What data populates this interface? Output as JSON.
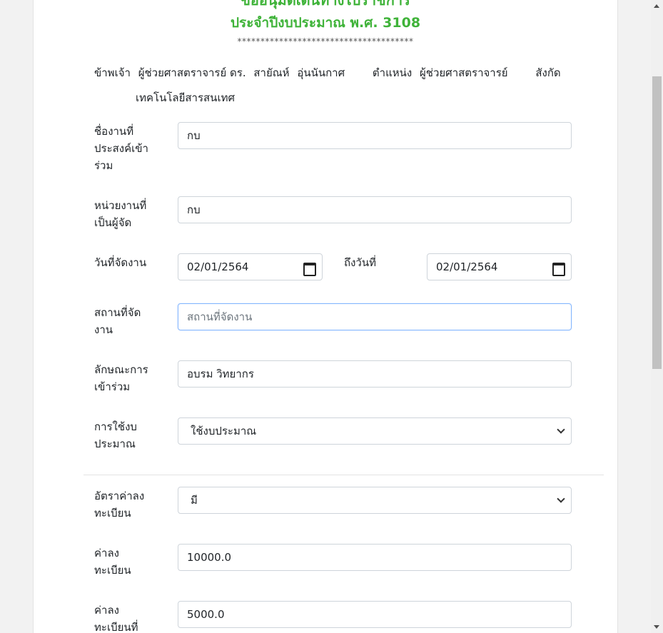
{
  "header": {
    "title_cut": "ขออนุมัติเดินทางไปราชการ",
    "subtitle": "ประจำปีงบประมาณ พ.ศ. 3108",
    "stars": "**************************************"
  },
  "info": {
    "prefix": "ข้าพเจ้า",
    "title": "ผู้ช่วยศาสตราจารย์ ดร.",
    "first_name": "สายัณห์",
    "last_name": "อุ่นนันกาศ",
    "position_label": "ตำแหน่ง",
    "position": "ผู้ช่วยศาสตราจารย์",
    "affiliation_label": "สังกัด",
    "affiliation": "เทคโนโลยีสารสนเทศ"
  },
  "form": {
    "event_name": {
      "label_1": "ชื่องานที่",
      "label_2": "ประสงค์เข้า",
      "label_3": "ร่วม",
      "value": "กบ"
    },
    "organizer": {
      "label_1": "หน่วยงานที่",
      "label_2": "เป็นผู้จัด",
      "value": "กบ"
    },
    "start_date": {
      "label": "วันที่จัดงาน",
      "value": "02/01/2564"
    },
    "end_date": {
      "label": "ถึงวันที่",
      "value": "02/01/2564"
    },
    "venue": {
      "label_1": "สถานที่จัด",
      "label_2": "งาน",
      "placeholder": "สถานที่จัดงาน"
    },
    "participation": {
      "label_1": "ลักษณะการ",
      "label_2": "เข้าร่วม",
      "value": "อบรม วิทยากร"
    },
    "budget": {
      "label_1": "การใช้งบ",
      "label_2": "ประมาณ",
      "value": "ใช้งบประมาณ"
    },
    "fee_rate": {
      "label_1": "อัตราค่าลง",
      "label_2": "ทะเบียน",
      "value": "มี"
    },
    "fee": {
      "label_1": "ค่าลง",
      "label_2": "ทะเบียน",
      "value": "10000.0"
    },
    "fee_used": {
      "label_1": "ค่าลง",
      "label_2": "ทะเบียนที่",
      "value": "5000.0"
    }
  }
}
